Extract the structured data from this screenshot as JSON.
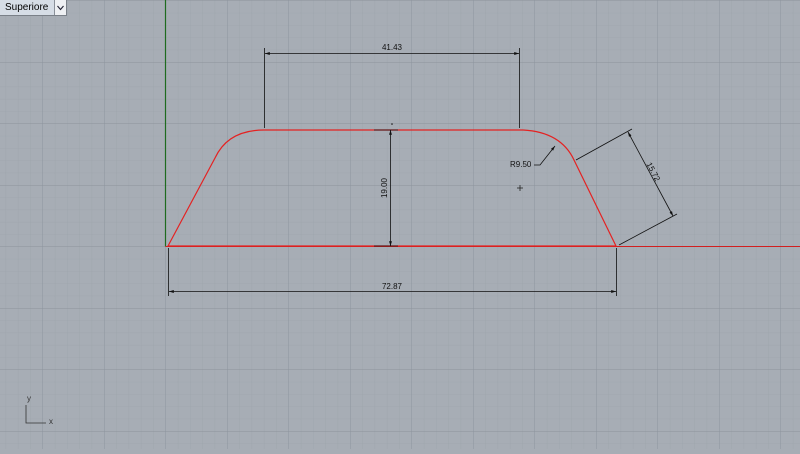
{
  "viewport": {
    "name": "Superiore",
    "dropdown_icon": "chevron-down-icon"
  },
  "dimensions": {
    "top_width": "41.43",
    "height": "19.00",
    "bottom_width": "72.87",
    "radius": "R9.50",
    "slant_length": "15.72"
  },
  "axis_icon": {
    "y": "y",
    "x": "x"
  },
  "colors": {
    "background": "#a7adb5",
    "grid_minor": "#9aa1a9",
    "grid_major": "#8c939c",
    "y_axis": "#1f6b1f",
    "x_axis": "#d11f1f",
    "profile": "#e42222",
    "dimension": "#111111"
  }
}
